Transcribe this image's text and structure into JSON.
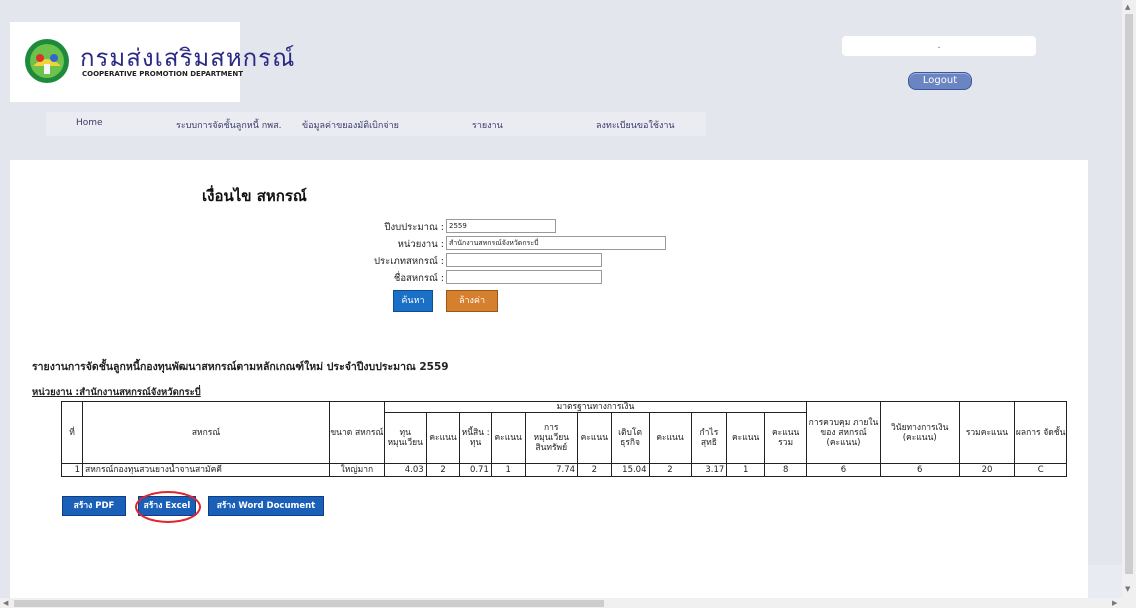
{
  "header": {
    "logo_th": "กรมส่งเสริมสหกรณ์",
    "logo_en": "COOPERATIVE PROMOTION DEPARTMENT",
    "user_box_text": ".",
    "logout_label": "Logout"
  },
  "nav": {
    "items": [
      {
        "label": "Home"
      },
      {
        "label": "ระบบการจัดชั้นลูกหนี้ กพส."
      },
      {
        "label": "ข้อมูลค่าขยองมัติเบิกจ่าย"
      },
      {
        "label": "รายงาน"
      },
      {
        "label": "ลงทะเบียนขอใช้งาน"
      }
    ]
  },
  "page_title": "เงื่อนไข สหกรณ์",
  "form": {
    "fiscal_year_label": "ปีงบประมาณ :",
    "fiscal_year_value": "2559",
    "agency_label": "หน่วยงาน :",
    "agency_value": "สำนักงานสหกรณ์จังหวัดกระบี่",
    "coop_type_label": "ประเภทสหกรณ์ :",
    "coop_type_value": "",
    "coop_name_label": "ชื่อสหกรณ์ :",
    "coop_name_value": "",
    "search_label": "ค้นหา",
    "clear_label": "ล้างค่า"
  },
  "report": {
    "title": "รายงานการจัดชั้นลูกหนี้กองทุนพัฒนาสหกรณ์ตามหลักเกณฑ์ใหม่ ประจำปีงบประมาณ 2559",
    "unit": "หน่วยงาน :สำนักงานสหกรณ์จังหวัดกระบี่",
    "headers": {
      "no": "ที่",
      "coop": "สหกรณ์",
      "size": "ขนาด สหกรณ์",
      "financial": "มาตรฐานทางการเงิน",
      "capital": "ทุน หมุนเวียน",
      "score1": "คะแนน",
      "debt": "หนี้สิน : ทุน",
      "score2": "คะแนน",
      "turnover": "การ หมุนเวียน สินทรัพย์",
      "score3": "คะแนน",
      "growth": "เติบโต ธุรกิจ",
      "score4": "คะแนน",
      "profit": "กำไร สุทธิ",
      "score5": "คะแนน",
      "total_score": "คะแนน รวม",
      "control": "การควบคุม ภายใน ของ สหกรณ์ (คะแนน)",
      "discipline": "วินัยทางการเงิน (คะแนน)",
      "sum": "รวมคะแนน",
      "result": "ผลการ จัดชั้น"
    },
    "rows": [
      {
        "no": "1",
        "coop": "สหกรณ์กองทุนสวนยางน้ำจานสามัคคี",
        "size": "ใหญ่มาก",
        "capital": "4.03",
        "score1": "2",
        "debt": "0.71",
        "score2": "1",
        "turnover": "7.74",
        "score3": "2",
        "growth": "15.04",
        "score4": "2",
        "profit": "3.17",
        "score5": "1",
        "total_score": "8",
        "control": "6",
        "discipline": "6",
        "sum": "20",
        "result": "C"
      }
    ]
  },
  "export": {
    "pdf_label": "สร้าง PDF",
    "excel_label": "สร้าง Excel",
    "word_label": "สร้าง Word Document"
  }
}
